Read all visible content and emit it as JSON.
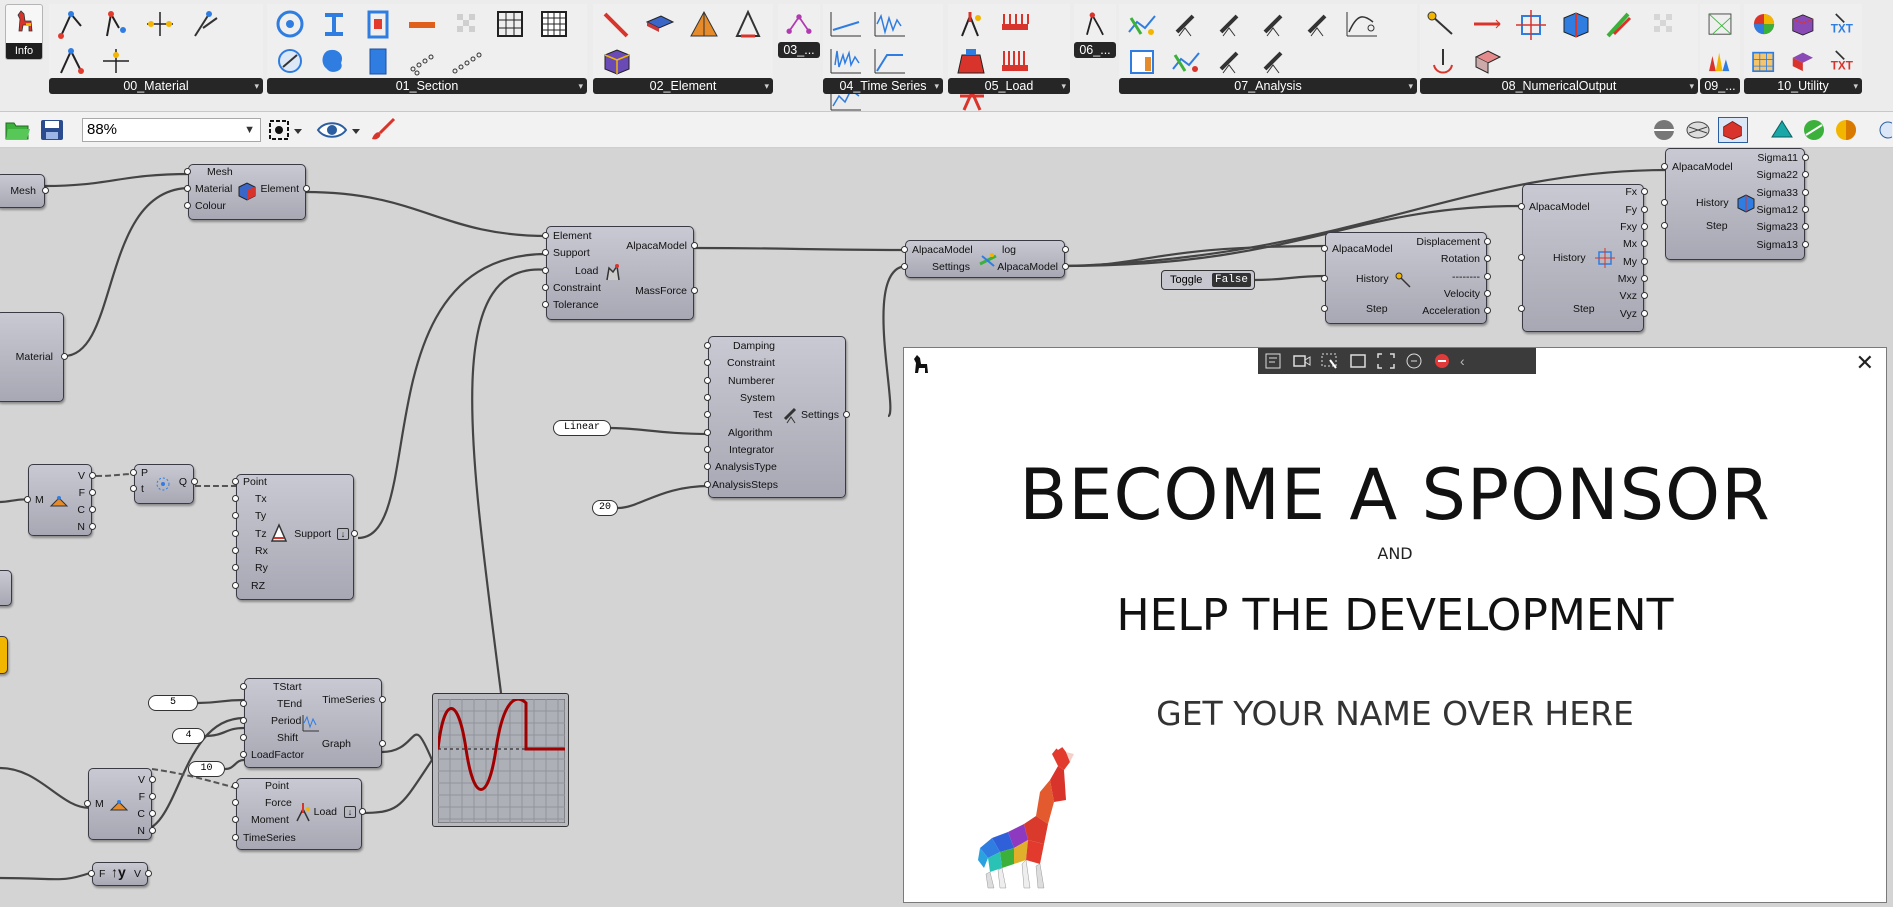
{
  "info_tab": {
    "label": "Info"
  },
  "ribbon_groups": [
    {
      "label": "00_Material"
    },
    {
      "label": "01_Section"
    },
    {
      "label": "02_Element"
    },
    {
      "label": "03_..."
    },
    {
      "label": "04_Time Series"
    },
    {
      "label": "05_Load"
    },
    {
      "label": "06_..."
    },
    {
      "label": "07_Analysis"
    },
    {
      "label": "08_NumericalOutput"
    },
    {
      "label": "09_..."
    },
    {
      "label": "10_Utility"
    }
  ],
  "toolbar": {
    "zoom": "88%"
  },
  "components": {
    "mesh": {
      "label": "Mesh"
    },
    "material": {
      "label": "Material"
    },
    "element": {
      "inputs": [
        "Mesh",
        "Material",
        "Colour"
      ],
      "output": "Element"
    },
    "assemble": {
      "inputs": [
        "Element",
        "Support",
        "Load",
        "Constraint",
        "Tolerance"
      ],
      "outputs": [
        "AlpacaModel",
        "MassForce"
      ]
    },
    "solver": {
      "inputs": [
        "AlpacaModel",
        "Settings"
      ],
      "outputs": [
        "log",
        "AlpacaModel"
      ]
    },
    "settings": {
      "inputs": [
        "Damping",
        "Constraint",
        "Numberer",
        "System",
        "Test",
        "Algorithm",
        "Integrator",
        "AnalysisType",
        "AnalysisSteps"
      ],
      "output": "Settings"
    },
    "support": {
      "inputs": [
        "Point",
        "Tx",
        "Ty",
        "Tz",
        "Rx",
        "Ry",
        "RZ"
      ],
      "output": "Support"
    },
    "timeseries": {
      "inputs": [
        "TStart",
        "TEnd",
        "Period",
        "Shift",
        "LoadFactor"
      ],
      "outputs": [
        "TimeSeries",
        "Graph"
      ]
    },
    "load": {
      "inputs": [
        "Point",
        "Force",
        "Moment",
        "TimeSeries"
      ],
      "output": "Load"
    },
    "node_disp": {
      "inputs": [
        "AlpacaModel",
        "History",
        "Step"
      ],
      "outputs": [
        "Displacement",
        "Rotation",
        "--------",
        "Velocity",
        "Acceleration"
      ]
    },
    "forces": {
      "inputs": [
        "AlpacaModel",
        "History",
        "Step"
      ],
      "outputs": [
        "Fx",
        "Fy",
        "Fxy",
        "Mx",
        "My",
        "Mxy",
        "Vxz",
        "Vyz"
      ]
    },
    "stress": {
      "inputs": [
        "AlpacaModel",
        "History",
        "Step"
      ],
      "outputs": [
        "Sigma11",
        "Sigma22",
        "Sigma33",
        "Sigma12",
        "Sigma23",
        "Sigma13"
      ]
    },
    "mesh_deconstruct_1": {
      "input": "M",
      "outputs": [
        "V",
        "F",
        "C",
        "N"
      ]
    },
    "mesh_deconstruct_2": {
      "input": "M",
      "outputs": [
        "V",
        "F",
        "C",
        "N"
      ]
    },
    "closest": {
      "inputs": [
        "P",
        "t"
      ],
      "output": "Q"
    },
    "vector": {
      "input": "F",
      "output": "V"
    }
  },
  "params": {
    "linear": "Linear",
    "steps": "20",
    "tstart": "5",
    "period": "4",
    "loadfactor": "10"
  },
  "toggle": {
    "label": "Toggle",
    "value": "False"
  },
  "popup": {
    "headline": "BECOME A SPONSOR",
    "and": "AND",
    "subhead": "HELP THE DEVELOPMENT",
    "cta": "GET YOUR NAME OVER HERE"
  }
}
